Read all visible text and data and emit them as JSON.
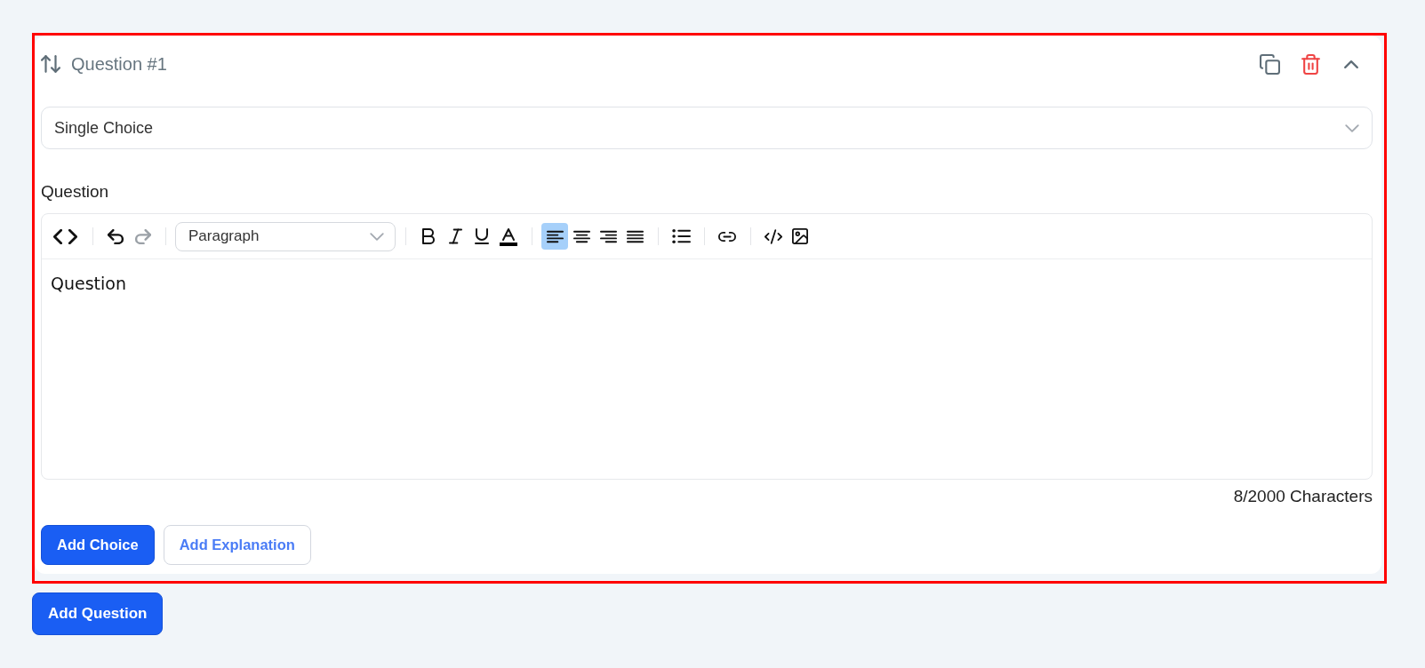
{
  "questions": [
    {
      "title": "Question #1",
      "highlighted": true,
      "expanded": true,
      "type_select": {
        "value": "Single Choice"
      },
      "field_label": "Question",
      "editor": {
        "toolbar": [
          {
            "kind": "buttons",
            "tools": [
              {
                "kind": "source",
                "active": false,
                "disabled": false
              }
            ]
          },
          {
            "kind": "buttons",
            "tools": [
              {
                "kind": "undo",
                "active": false,
                "disabled": false
              },
              {
                "kind": "redo",
                "active": false,
                "disabled": true
              }
            ]
          },
          {
            "kind": "select",
            "value": "Paragraph"
          },
          {
            "kind": "buttons",
            "tools": [
              {
                "kind": "bold",
                "active": false,
                "disabled": false
              },
              {
                "kind": "italic",
                "active": false,
                "disabled": false
              },
              {
                "kind": "underline",
                "active": false,
                "disabled": false
              },
              {
                "kind": "text-color",
                "active": false,
                "disabled": false
              }
            ]
          },
          {
            "kind": "buttons",
            "tools": [
              {
                "kind": "align-left",
                "active": true,
                "disabled": false
              },
              {
                "kind": "align-center",
                "active": false,
                "disabled": false
              },
              {
                "kind": "align-right",
                "active": false,
                "disabled": false
              },
              {
                "kind": "justify",
                "active": false,
                "disabled": false
              }
            ]
          },
          {
            "kind": "buttons",
            "tools": [
              {
                "kind": "bullet-list",
                "active": false,
                "disabled": false
              }
            ]
          },
          {
            "kind": "buttons",
            "tools": [
              {
                "kind": "link",
                "active": false,
                "disabled": false
              }
            ]
          },
          {
            "kind": "buttons",
            "tools": [
              {
                "kind": "code",
                "active": false,
                "disabled": false
              },
              {
                "kind": "image",
                "active": false,
                "disabled": false
              }
            ]
          }
        ],
        "content": "Question",
        "counter": "8/2000 Characters"
      },
      "actions": [
        {
          "label": "Add Choice",
          "kind": "primary"
        },
        {
          "label": "Add Explanation",
          "kind": "outline"
        }
      ]
    }
  ],
  "add_button": "Add Question"
}
